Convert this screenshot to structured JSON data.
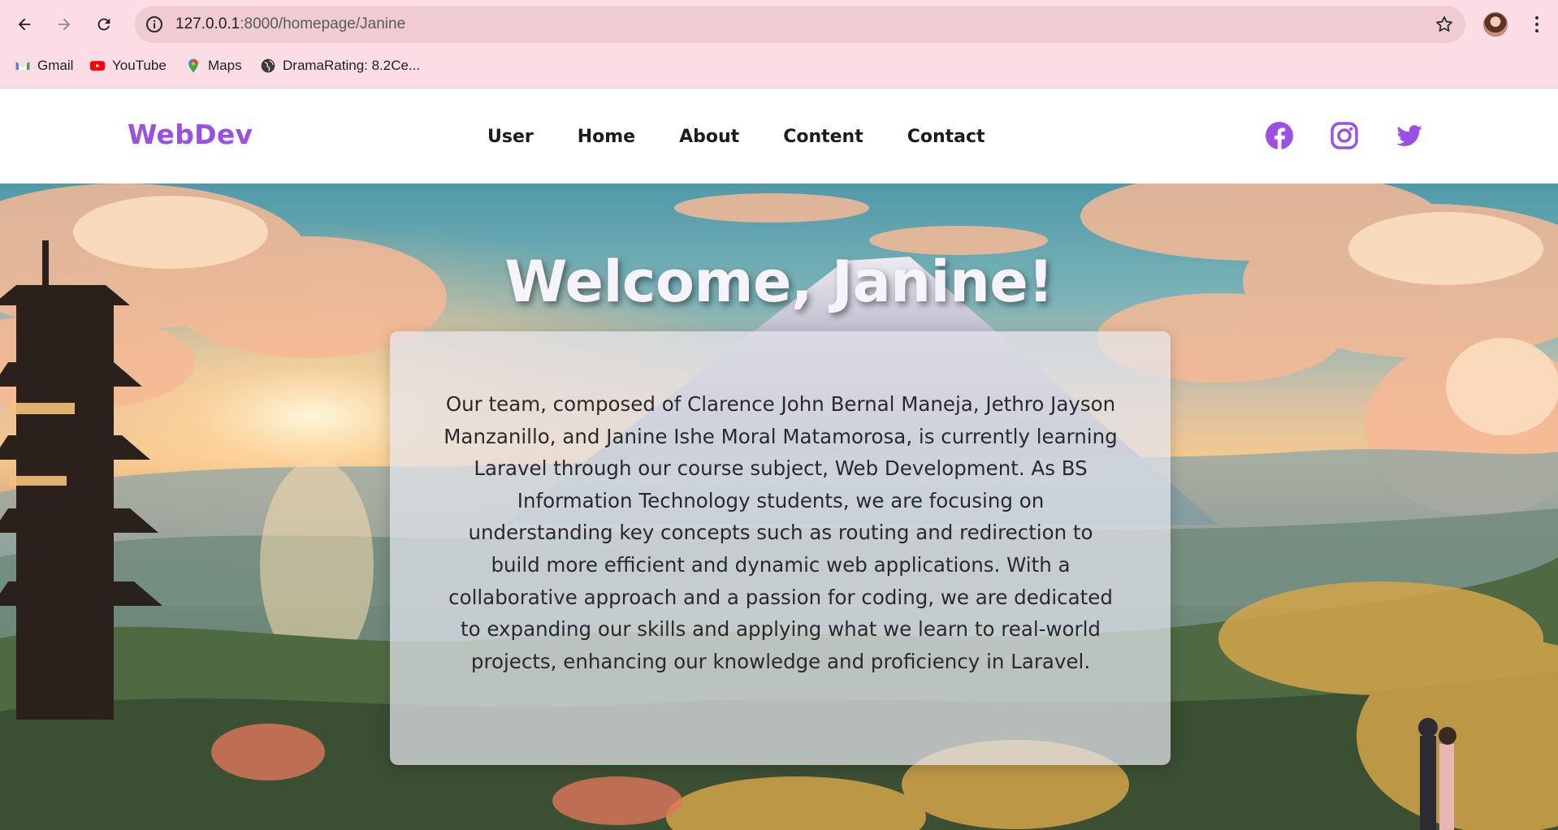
{
  "browser": {
    "url_host": "127.0.0.1",
    "url_path": ":8000/homepage/Janine",
    "bookmarks": [
      {
        "label": "Gmail",
        "icon": "gmail-icon"
      },
      {
        "label": "YouTube",
        "icon": "youtube-icon"
      },
      {
        "label": "Maps",
        "icon": "maps-icon"
      },
      {
        "label": "DramaRating: 8.2Ce...",
        "icon": "globe-icon"
      }
    ]
  },
  "site": {
    "brand": "WebDev",
    "nav": [
      "User",
      "Home",
      "About",
      "Content",
      "Contact"
    ],
    "social": [
      "facebook-icon",
      "instagram-icon",
      "twitter-icon"
    ],
    "colors": {
      "brand": "#9b4fe8",
      "accent": "#9b4fe8"
    }
  },
  "hero": {
    "title": "Welcome, Janine!",
    "intro": "Our team, composed of Clarence John Bernal Maneja, Jethro Jayson Manzanillo, and Janine Ishe Moral Matamorosa, is currently learning Laravel through our course subject, Web Development. As BS Information Technology students, we are focusing on understanding key concepts such as routing and redirection to build more efficient and dynamic web applications. With a collaborative approach and a passion for coding, we are dedicated to expanding our skills and applying what we learn to real-world projects, enhancing our knowledge and proficiency in Laravel."
  }
}
